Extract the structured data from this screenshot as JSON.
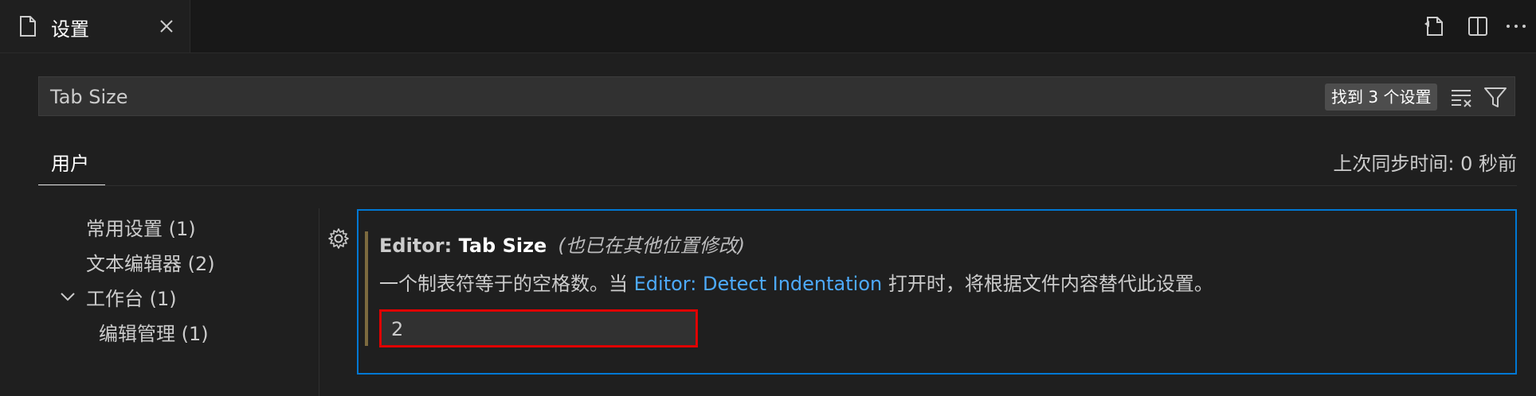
{
  "tab": {
    "title": "设置"
  },
  "search": {
    "value": "Tab Size",
    "results_badge": "找到 3 个设置"
  },
  "scope": {
    "user_tab": "用户",
    "sync_status": "上次同步时间: 0 秒前"
  },
  "toc": {
    "items": [
      {
        "label": "常用设置 (1)"
      },
      {
        "label": "文本编辑器 (2)"
      },
      {
        "label": "工作台 (1)"
      },
      {
        "label": "编辑管理 (1)"
      }
    ]
  },
  "setting": {
    "category": "Editor: ",
    "name": "Tab Size",
    "modified_note": "(也已在其他位置修改)",
    "desc_before": "一个制表符等于的空格数。当 ",
    "desc_link": "Editor: Detect Indentation",
    "desc_after": " 打开时，将根据文件内容替代此设置。",
    "value": "2"
  },
  "icons": {
    "tab": "file-icon",
    "close": "close-icon",
    "open_json": "open-settings-json-icon",
    "split": "split-editor-icon",
    "more": "more-actions-icon",
    "clear_filter": "clear-filter-icon",
    "filter": "filter-icon",
    "chevron": "chevron-down-icon",
    "gear": "gear-icon"
  },
  "colors": {
    "accent": "#0078d4",
    "link": "#4daafc",
    "highlight": "#e00000",
    "modified": "#7c6a3f"
  }
}
